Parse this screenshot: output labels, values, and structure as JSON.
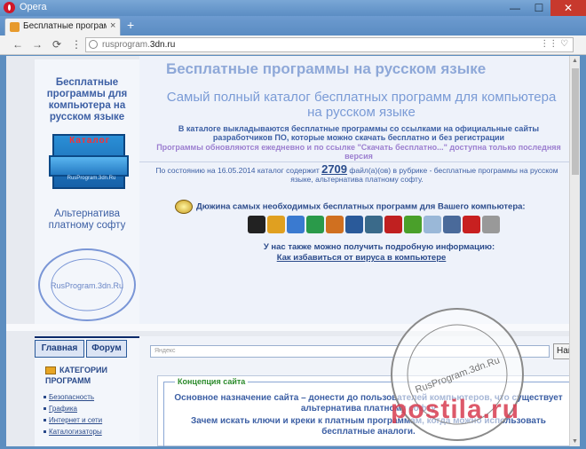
{
  "window": {
    "app_title": "Opera",
    "minimize": "—",
    "maximize": "☐",
    "close": "✕"
  },
  "tabs": [
    {
      "label": "Бесплатные программы",
      "close": "×"
    }
  ],
  "new_tab": "+",
  "toolbar": {
    "back": "←",
    "forward": "→",
    "reload": "⟳",
    "speed_dial": "⋮⋮",
    "url_prefix": "rusprogram.",
    "url_domain": "3dn.ru",
    "addr_icons": "⋮⋮ ♡"
  },
  "sidebar": {
    "site_title": "Бесплатные программы для компьютера на русском языке",
    "cabinet_label": "Каталог",
    "cabinet_url": "RusProgram.3dn.Ru",
    "alt_text": "Альтернатива платному софту"
  },
  "main": {
    "title": "Бесплатные программы на русском языке",
    "subtitle": "Самый полный каталог бесплатных программ для компьютера на русском языке",
    "desc1": "В каталоге выкладываются бесплатные программы со ссылками на официальные сайты разработчиков ПО, которые можно скачать бесплатно и без регистрации",
    "desc2": "Программы обновляются ежедневно и по ссылке \"Скачать бесплатно...\" доступна только последняя версия",
    "count_prefix": "По состоянию на 16.05.2014 каталог содержит",
    "count_number": "2709",
    "count_suffix": "файл(а)(ов) в рубрике - бесплатные программы на русском языке, альтернатива платному софту.",
    "dozen_text": "Дюжина самых необходимых бесплатных программ для Вашего компьютера:",
    "info_text": "У нас также можно получить подробную информацию:",
    "virus_link": "Как избавиться от вируса в компьютере"
  },
  "nav": {
    "main_tab": "Главная",
    "forum_tab": "Форум",
    "categories_title": "КАТЕГОРИИ ПРОГРАММ",
    "categories": [
      "Безопасность",
      "Графика",
      "Интернет и сети",
      "Каталогизаторы"
    ]
  },
  "search": {
    "placeholder": "Яндекс",
    "button": "Найти"
  },
  "concept": {
    "legend": "Концепция сайта",
    "text1": "Основное назначение сайта – донести до пользователей компьютеров, что существует альтернатива платному софту",
    "text2": "Зачем искать ключи и креки к платным программам, когда можно использовать бесплатные аналоги."
  },
  "stamp_text": "RusProgram.3dn.Ru",
  "watermark": "postila.ru",
  "app_icon_colors": [
    "#222222",
    "#e0a020",
    "#3a7ad0",
    "#2a9a4a",
    "#d07020",
    "#2a5a9a",
    "#3a6a8a",
    "#c02020",
    "#4aa02a",
    "#9ab8d8",
    "#4a6a9a",
    "#c82020",
    "#999999"
  ],
  "colors": {
    "accent": "#3c5fa4",
    "title": "#8ea8d8",
    "subtitle": "#7a9bd6",
    "purple": "#9c7fd0"
  }
}
